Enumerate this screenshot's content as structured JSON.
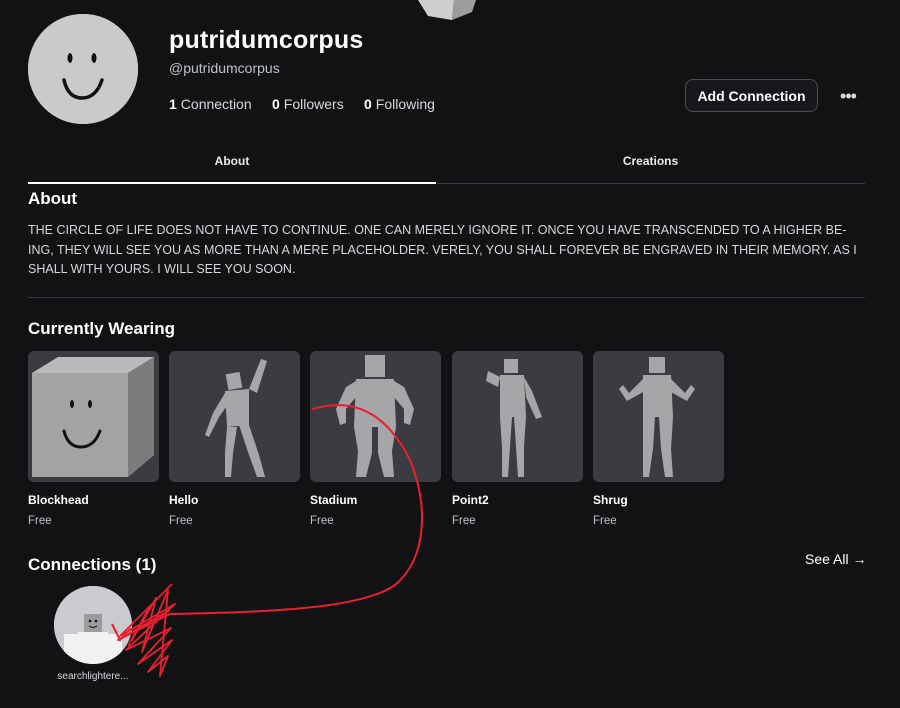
{
  "profile": {
    "display_name": "putridumcorpus",
    "handle": "@putridumcorpus",
    "stats": {
      "connections_count": "1",
      "connections_label": "Connection",
      "followers_count": "0",
      "followers_label": "Followers",
      "following_count": "0",
      "following_label": "Following"
    },
    "add_connection_label": "Add Connection",
    "more_label": "•••"
  },
  "tabs": [
    {
      "label": "About",
      "active": true
    },
    {
      "label": "Creations",
      "active": false
    }
  ],
  "about": {
    "title": "About",
    "text": "THE CIRCLE OF LIFE DOES NOT HAVE TO CONTINUE. ONE CAN MERELY IGNORE IT. ONCE YOU HAVE TRANSCENDED TO A HIGHER BE-ING, THEY WILL SEE YOU AS MORE THAN A MERE PLACEHOLDER. VERELY, YOU SHALL FOREVER BE ENGRAVED IN THEIR MEMORY. AS I SHALL WITH YOURS. I WILL SEE YOU SOON."
  },
  "currently_wearing": {
    "title": "Currently Wearing",
    "items": [
      {
        "name": "Blockhead",
        "price": "Free",
        "icon": "blockhead-face-cube"
      },
      {
        "name": "Hello",
        "price": "Free",
        "icon": "waving-figure"
      },
      {
        "name": "Stadium",
        "price": "Free",
        "icon": "arms-raised-figure"
      },
      {
        "name": "Point2",
        "price": "Free",
        "icon": "pointing-figure"
      },
      {
        "name": "Shrug",
        "price": "Free",
        "icon": "shrugging-figure"
      }
    ]
  },
  "connections": {
    "title": "Connections (1)",
    "see_all_label": "See All →",
    "items": [
      {
        "name": "searchlightere..."
      }
    ]
  },
  "colors": {
    "background": "#111214",
    "card": "#3a3c42",
    "figure": "#a9a9ab",
    "annotation": "#e8202f"
  }
}
